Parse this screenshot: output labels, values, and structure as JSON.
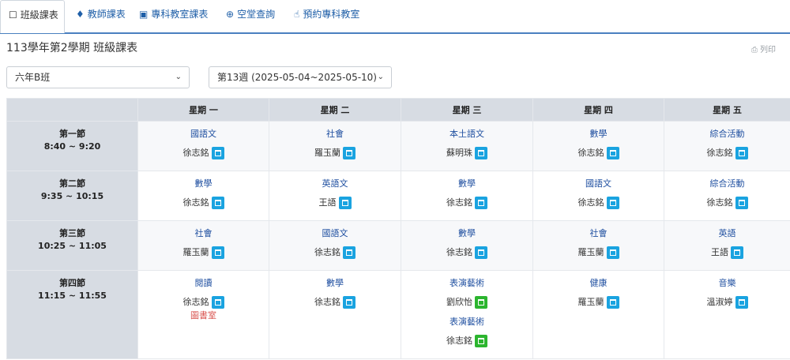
{
  "tabs": [
    {
      "label": "班級課表",
      "icon": "square-icon",
      "glyph": "☐",
      "active": true
    },
    {
      "label": "教師課表",
      "icon": "person-icon",
      "glyph": "♦",
      "active": false
    },
    {
      "label": "專科教室課表",
      "icon": "book-icon",
      "glyph": "▣",
      "active": false
    },
    {
      "label": "空堂查詢",
      "icon": "search-icon",
      "glyph": "⊕",
      "active": false
    },
    {
      "label": "預約專科教室",
      "icon": "hand-pointer-icon",
      "glyph": "☝",
      "active": false
    }
  ],
  "page": {
    "title": "113學年第2學期 班級課表",
    "print_label": "列印",
    "print_glyph": "⎙"
  },
  "filters": {
    "class_value": "六年B班",
    "week_value": "第13週 (2025-05-04~2025-05-10)",
    "chevron": "⌄"
  },
  "timetable": {
    "days": [
      "星期 一",
      "星期 二",
      "星期 三",
      "星期 四",
      "星期 五"
    ],
    "periods": [
      {
        "name": "第一節",
        "time": "8:40 ~ 9:20"
      },
      {
        "name": "第二節",
        "time": "9:35 ~ 10:15"
      },
      {
        "name": "第三節",
        "time": "10:25 ~ 11:05"
      },
      {
        "name": "第四節",
        "time": "11:15 ~ 11:55"
      }
    ],
    "cells": [
      [
        [
          {
            "subject": "國語文",
            "teacher": "徐志銘"
          }
        ],
        [
          {
            "subject": "社會",
            "teacher": "羅玉蘭"
          }
        ],
        [
          {
            "subject": "本土語文",
            "teacher": "蘇明珠"
          }
        ],
        [
          {
            "subject": "數學",
            "teacher": "徐志銘"
          }
        ],
        [
          {
            "subject": "綜合活動",
            "teacher": "徐志銘"
          }
        ]
      ],
      [
        [
          {
            "subject": "數學",
            "teacher": "徐志銘"
          }
        ],
        [
          {
            "subject": "英語文",
            "teacher": "王語"
          }
        ],
        [
          {
            "subject": "數學",
            "teacher": "徐志銘"
          }
        ],
        [
          {
            "subject": "國語文",
            "teacher": "徐志銘"
          }
        ],
        [
          {
            "subject": "綜合活動",
            "teacher": "徐志銘"
          }
        ]
      ],
      [
        [
          {
            "subject": "社會",
            "teacher": "羅玉蘭"
          }
        ],
        [
          {
            "subject": "國語文",
            "teacher": "徐志銘"
          }
        ],
        [
          {
            "subject": "數學",
            "teacher": "徐志銘"
          }
        ],
        [
          {
            "subject": "社會",
            "teacher": "羅玉蘭"
          }
        ],
        [
          {
            "subject": "英語",
            "teacher": "王語"
          }
        ]
      ],
      [
        [
          {
            "subject": "閱讀",
            "teacher": "徐志銘",
            "room": "圖書室"
          }
        ],
        [
          {
            "subject": "數學",
            "teacher": "徐志銘"
          }
        ],
        [
          {
            "subject": "表演藝術",
            "teacher": "劉欣怡",
            "green": true
          },
          {
            "subject": "表演藝術",
            "teacher": "徐志銘",
            "green": true
          }
        ],
        [
          {
            "subject": "健康",
            "teacher": "羅玉蘭"
          }
        ],
        [
          {
            "subject": "音樂",
            "teacher": "溫淑婷"
          }
        ]
      ]
    ]
  },
  "colors": {
    "accent": "#4a80c0",
    "link": "#1f4fa0",
    "header_bg": "#d7dce3",
    "calendar_blue": "#1aa3e0",
    "calendar_green": "#2cb52f",
    "highlight": "#ffe600",
    "room": "#d9534f"
  }
}
